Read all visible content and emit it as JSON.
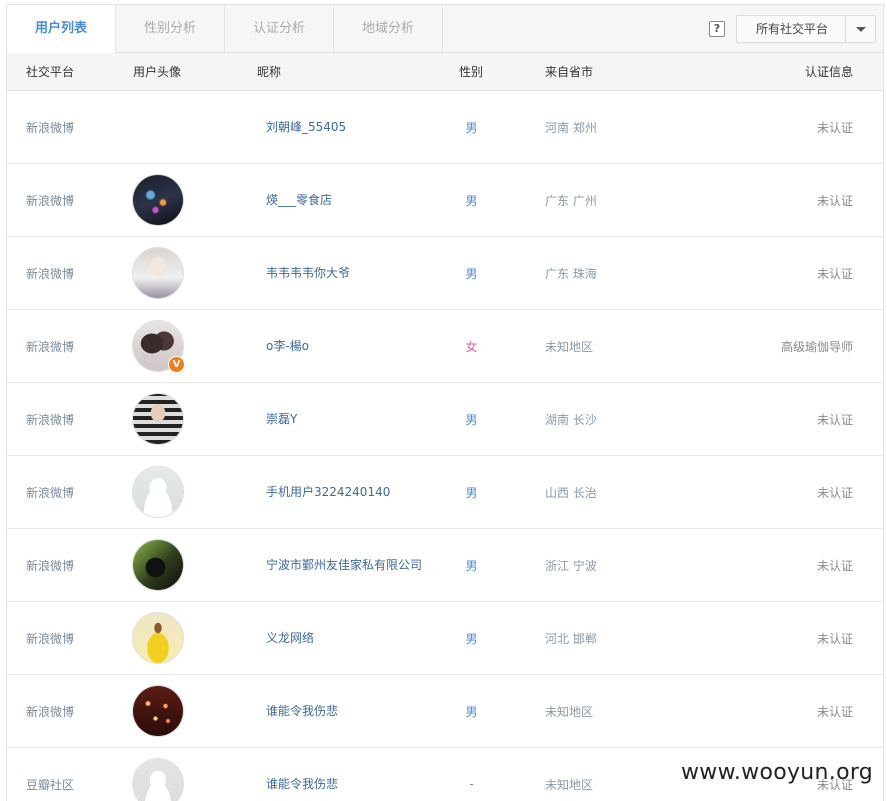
{
  "tabs": [
    {
      "label": "用户列表",
      "active": true
    },
    {
      "label": "性别分析",
      "active": false
    },
    {
      "label": "认证分析",
      "active": false
    },
    {
      "label": "地域分析",
      "active": false
    }
  ],
  "help_label": "?",
  "platform_select": {
    "value": "所有社交平台"
  },
  "columns": {
    "platform": "社交平台",
    "avatar": "用户头像",
    "nickname": "昵称",
    "gender": "性别",
    "region": "来自省市",
    "verify": "认证信息"
  },
  "rows": [
    {
      "platform": "新浪微博",
      "avatar": "none",
      "nickname": "刘朝峰_55405",
      "gender": "男",
      "region": "河南 郑州",
      "verify": "未认证"
    },
    {
      "platform": "新浪微博",
      "avatar": "photo-dark-lights",
      "nickname": "煐___零食店",
      "gender": "男",
      "region": "广东 广州",
      "verify": "未认证"
    },
    {
      "platform": "新浪微博",
      "avatar": "photo-person-sunglasses",
      "nickname": "韦韦韦韦你大爷",
      "gender": "男",
      "region": "广东 珠海",
      "verify": "未认证"
    },
    {
      "platform": "新浪微博",
      "avatar": "photo-couple",
      "nickname": "o李-楊o",
      "gender": "女",
      "region": "未知地区",
      "verify": "高级瑜伽导师",
      "badge": "V"
    },
    {
      "platform": "新浪微博",
      "avatar": "photo-person-sunglasses-2",
      "nickname": "崇磊Y",
      "gender": "男",
      "region": "湖南 长沙",
      "verify": "未认证"
    },
    {
      "platform": "新浪微博",
      "avatar": "default-silhouette",
      "nickname": "手机用户3224240140",
      "gender": "男",
      "region": "山西 长治",
      "verify": "未认证"
    },
    {
      "platform": "新浪微博",
      "avatar": "photo-green-dark",
      "nickname": "宁波市鄞州友佳家私有限公司",
      "gender": "男",
      "region": "浙江 宁波",
      "verify": "未认证"
    },
    {
      "platform": "新浪微博",
      "avatar": "photo-yellow-figure",
      "nickname": "义龙网络",
      "gender": "男",
      "region": "河北 邯郸",
      "verify": "未认证"
    },
    {
      "platform": "新浪微博",
      "avatar": "photo-red-lights",
      "nickname": "谁能令我伤悲",
      "gender": "男",
      "region": "未知地区",
      "verify": "未认证"
    },
    {
      "platform": "豆瓣社区",
      "avatar": "default-gray",
      "nickname": "谁能令我伤悲",
      "gender": "-",
      "region": "未知地区",
      "verify": "未认证"
    }
  ],
  "watermark": "www.wooyun.org",
  "colors": {
    "accent": "#4a8bd1",
    "female": "#e05fa0",
    "badge": "#f07c1a"
  }
}
